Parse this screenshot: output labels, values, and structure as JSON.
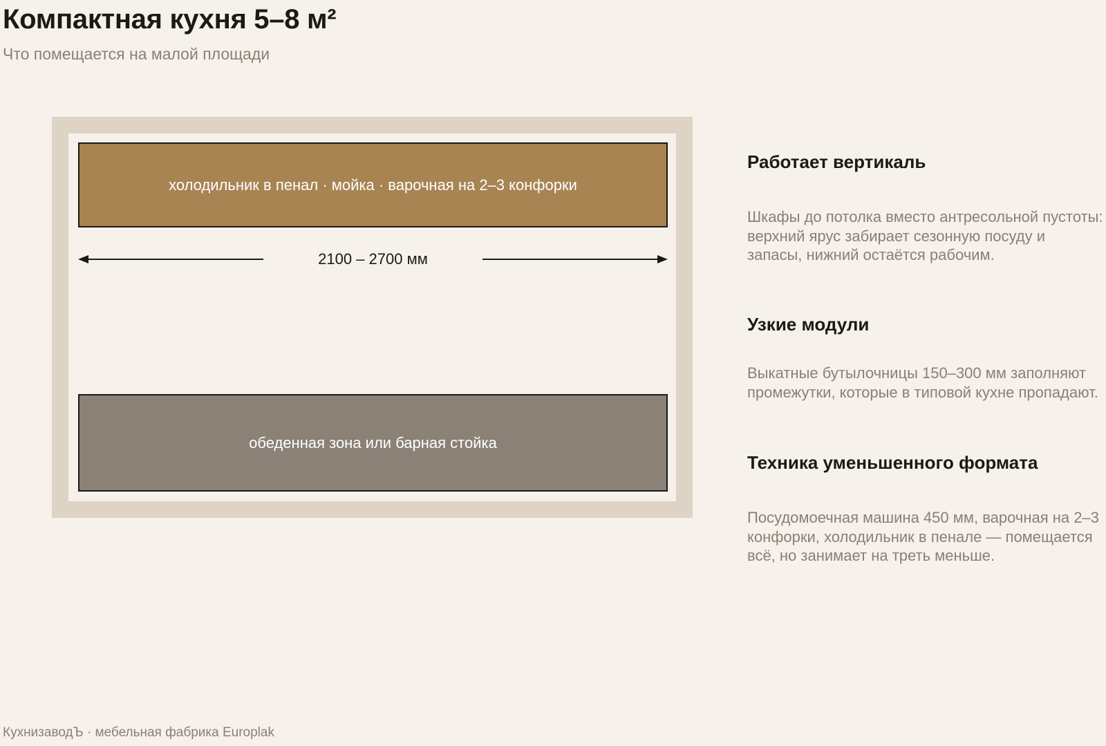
{
  "header": {
    "title": "Компактная кухня 5–8 м²",
    "subtitle": "Что помещается на малой площади"
  },
  "plan": {
    "work_zone_label": "холодильник в пенал · мойка · варочная на 2–3 конфорки",
    "dining_zone_label": "обеденная зона или барная стойка",
    "dimension_label": "2100 – 2700 мм"
  },
  "tips": [
    {
      "title": "Работает вертикаль",
      "text": "Шкафы до потолка вместо антресольной пустоты: верхний ярус забирает сезонную посуду и запасы, нижний остаётся рабочим."
    },
    {
      "title": "Узкие модули",
      "text": "Выкатные бутылочницы 150–300 мм заполняют промежутки, которые в типовой кухне пропадают."
    },
    {
      "title": "Техника уменьшенного формата",
      "text": "Посудомоечная машина 450 мм, варочная на 2–3 конфорки, холодильник в пенале — помещается всё, но занимает на треть меньше."
    }
  ],
  "footer": {
    "text": "КухнизаводЪ · мебельная фабрика Europlak"
  },
  "colors": {
    "background": "#f6f1ea",
    "frame": "#ddd4c6",
    "work_zone": "#a88453",
    "dining_zone": "#8b8177",
    "text_primary": "#1c1917",
    "text_muted": "#8a7f74"
  }
}
